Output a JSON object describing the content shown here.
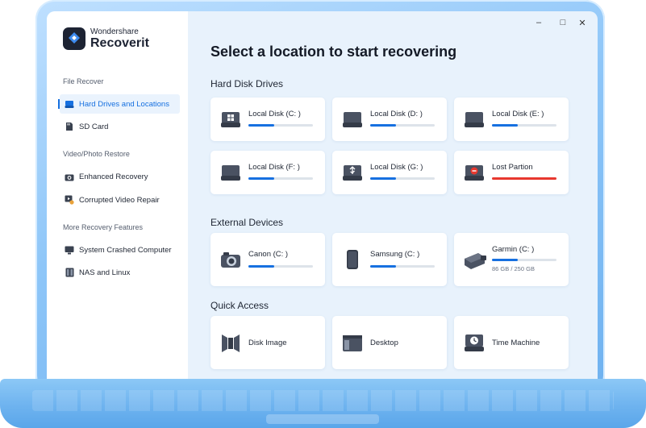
{
  "brand": {
    "top": "Wondershare",
    "main": "Recoverit"
  },
  "window_controls": {
    "minimize": "–",
    "maximize": "□",
    "close": "✕"
  },
  "sidebar": {
    "sections": [
      {
        "title": "File Recover",
        "items": [
          {
            "label": "Hard Drives and Locations",
            "icon": "hard-drive-icon",
            "active": true
          },
          {
            "label": "SD Card",
            "icon": "sd-card-icon",
            "active": false
          }
        ]
      },
      {
        "title": "Video/Photo Restore",
        "items": [
          {
            "label": "Enhanced Recovery",
            "icon": "camera-icon",
            "active": false
          },
          {
            "label": "Corrupted Video Repair",
            "icon": "video-repair-icon",
            "active": false
          }
        ]
      },
      {
        "title": "More Recovery Features",
        "items": [
          {
            "label": "System Crashed Computer",
            "icon": "monitor-icon",
            "active": false
          },
          {
            "label": "NAS and Linux",
            "icon": "nas-icon",
            "active": false
          }
        ]
      }
    ]
  },
  "main": {
    "title": "Select a location to start recovering",
    "groups": {
      "hard_disk": {
        "title": "Hard Disk Drives",
        "cards": [
          {
            "name": "Local Disk (C: )",
            "icon": "windows-disk-icon",
            "usage": 0.4
          },
          {
            "name": "Local Disk (D: )",
            "icon": "disk-icon",
            "usage": 0.4
          },
          {
            "name": "Local Disk (E: )",
            "icon": "disk-icon",
            "usage": 0.4
          },
          {
            "name": "Local Disk (F: )",
            "icon": "disk-icon",
            "usage": 0.4
          },
          {
            "name": "Local Disk (G: )",
            "icon": "usb-disk-icon",
            "usage": 0.4
          },
          {
            "name": "Lost Partion",
            "icon": "lost-partition-icon",
            "usage": 1.0
          }
        ]
      },
      "external": {
        "title": "External Devices",
        "cards": [
          {
            "name": "Canon (C: )",
            "icon": "camera-device-icon",
            "usage": 0.4
          },
          {
            "name": "Samsung (C: )",
            "icon": "phone-icon",
            "usage": 0.4
          },
          {
            "name": "Garmin (C: )",
            "icon": "garmin-device-icon",
            "usage": 0.4,
            "sub": "86 GB / 250 GB"
          }
        ]
      },
      "quick_access": {
        "title": "Quick Access",
        "cards": [
          {
            "name": "Disk Image",
            "icon": "disk-image-icon"
          },
          {
            "name": "Desktop",
            "icon": "desktop-icon"
          },
          {
            "name": "Time Machine",
            "icon": "time-machine-icon"
          }
        ]
      }
    }
  },
  "colors": {
    "accent": "#1670e0",
    "danger": "#e8382f",
    "background": "#e8f2fc",
    "frame": "#8ec6f8"
  }
}
